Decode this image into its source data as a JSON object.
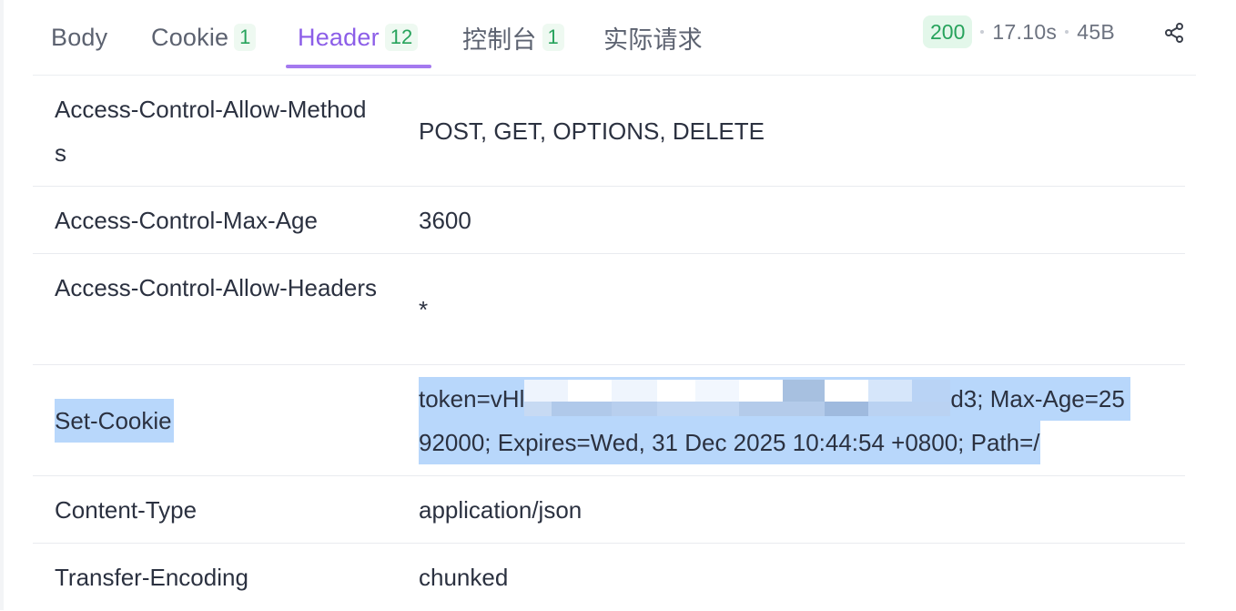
{
  "tabs": [
    {
      "label": "Body",
      "badge": null
    },
    {
      "label": "Cookie",
      "badge": "1"
    },
    {
      "label": "Header",
      "badge": "12"
    },
    {
      "label": "控制台",
      "badge": "1"
    },
    {
      "label": "实际请求",
      "badge": null
    }
  ],
  "active_tab": "Header",
  "status": {
    "code": "200",
    "time": "17.10s",
    "size": "45B"
  },
  "icons": {
    "share": "share-icon"
  },
  "colors": {
    "accent": "#8c5ee8",
    "success": "#27a35c",
    "selection": "#b8d7fb"
  },
  "headers": [
    {
      "key": "Access-Control-Allow-Methods",
      "value": "POST, GET, OPTIONS, DELETE"
    },
    {
      "key": "Access-Control-Max-Age",
      "value": "3600"
    },
    {
      "key": "Access-Control-Allow-Headers",
      "value": "*"
    },
    {
      "key": "Set-Cookie",
      "value_prefix": "token=vHl",
      "value_suffix": "d3; Max-Age=25",
      "value_line2": "92000; Expires=Wed, 31 Dec 2025 10:44:54 +0800; Path=/"
    },
    {
      "key": "Content-Type",
      "value": "application/json"
    },
    {
      "key": "Transfer-Encoding",
      "value": "chunked"
    }
  ]
}
